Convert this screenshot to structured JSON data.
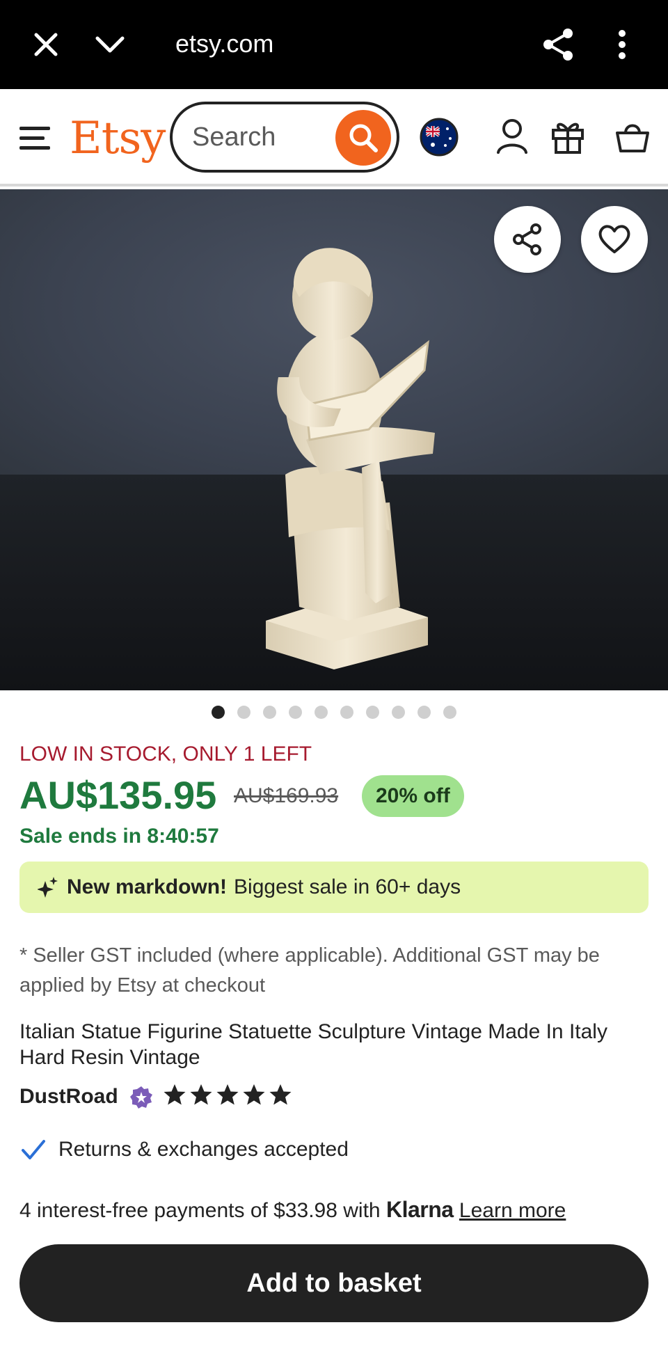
{
  "browser": {
    "url": "etsy.com",
    "icons": [
      "close-icon",
      "chevron-down-icon",
      "share-icon",
      "more-vert-icon"
    ]
  },
  "header": {
    "logo": "Etsy",
    "search_placeholder": "Search",
    "icons": [
      "menu-icon",
      "search-icon",
      "australia-flag-icon",
      "account-icon",
      "gift-icon",
      "basket-icon"
    ],
    "accent_color": "#f1641e"
  },
  "gallery": {
    "image_count": 10,
    "active_index": 0,
    "icons": [
      "share-icon",
      "heart-icon"
    ]
  },
  "listing": {
    "stock_notice": "LOW IN STOCK, ONLY 1 LEFT",
    "price": "AU$135.95",
    "original_price": "AU$169.93",
    "discount_badge": "20% off",
    "sale_ends": "Sale ends in 8:40:57",
    "markdown_bold": "New markdown!",
    "markdown_rest": "Biggest sale in 60+ days",
    "gst_note": "* Seller GST included (where applicable). Additional GST may be applied by Etsy at checkout",
    "title": "Italian Statue Figurine Statuette Sculpture Vintage Made In Italy Hard Resin Vintage",
    "seller": "DustRoad",
    "rating": 5,
    "returns": "Returns & exchanges accepted",
    "klarna_prefix": "4 interest-free payments of $33.98 with",
    "klarna_brand": "Klarna",
    "klarna_link": "Learn more",
    "add_to_basket": "Add to basket"
  },
  "colors": {
    "price_green": "#1f7a3e",
    "stock_red": "#a61a2e",
    "badge_green": "#a0e18e",
    "markdown_bg": "#e5f6ae"
  }
}
